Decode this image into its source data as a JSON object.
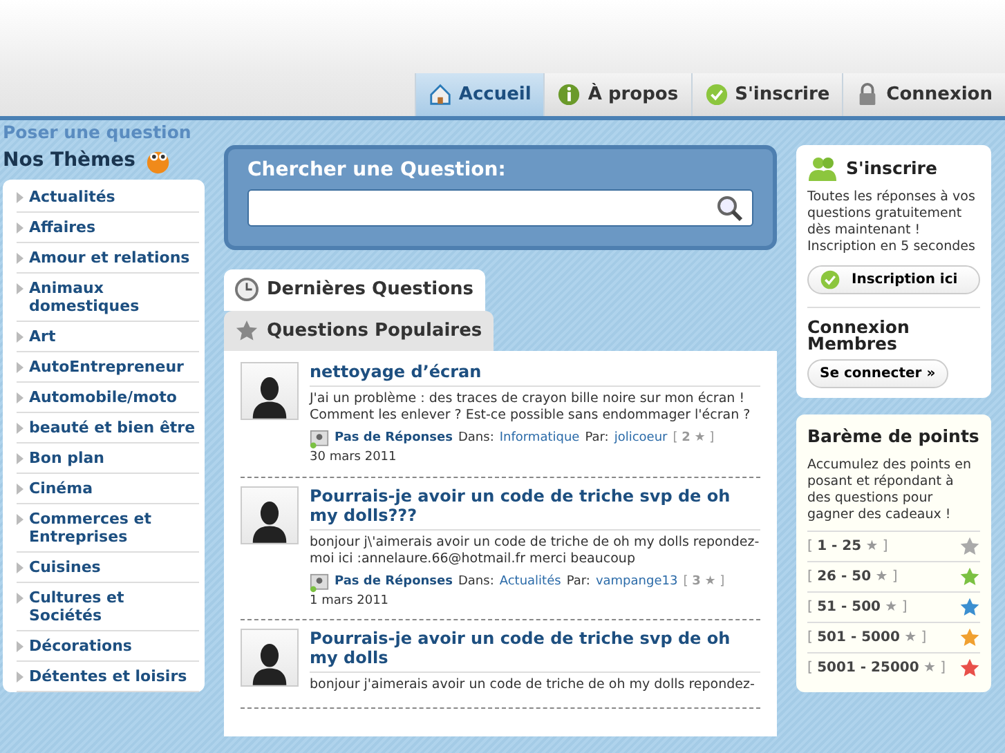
{
  "logo_text": "Poser une question",
  "nav": [
    {
      "label": "Accueil",
      "selected": true
    },
    {
      "label": "À propos",
      "selected": false
    },
    {
      "label": "S'inscrire",
      "selected": false
    },
    {
      "label": "Connexion",
      "selected": false
    }
  ],
  "sidebar": {
    "title": "Nos Thèmes",
    "items": [
      "Actualités",
      "Affaires",
      "Amour et relations",
      "Animaux domestiques",
      "Art",
      "AutoEntrepreneur",
      "Automobile/moto",
      "beauté et bien être",
      "Bon plan",
      "Cinéma",
      "Commerces et Entreprises",
      "Cuisines",
      "Cultures et Sociétés",
      "Décorations",
      "Détentes et loisirs"
    ]
  },
  "search": {
    "title": "Chercher une Question:"
  },
  "tabs": [
    {
      "label": "Dernières Questions",
      "selected": true
    },
    {
      "label": "Questions Populaires",
      "selected": false
    }
  ],
  "questions": [
    {
      "title": "nettoyage d’écran",
      "text": "J'ai un problème : des traces de crayon bille noire sur mon écran ! Comment les enlever ? Est-ce possible sans endommager l'écran ?",
      "status": "Pas de Réponses",
      "in_label": "Dans:",
      "category": "Informatique",
      "by_label": "Par:",
      "author": "jolicoeur",
      "points": "[ **2** ★ ]",
      "date": "30 mars 2011"
    },
    {
      "title": "Pourrais-je avoir un code de triche svp de oh my dolls???",
      "text": "bonjour j\\'aimerais avoir un code de triche de oh my dolls repondez-moi ici :annelaure.66@hotmail.fr merci beaucoup",
      "status": "Pas de Réponses",
      "in_label": "Dans:",
      "category": "Actualités",
      "by_label": "Par:",
      "author": "vampange13",
      "points": "[ **3** ★ ]",
      "date": "1 mars 2011"
    },
    {
      "title": "Pourrais-je avoir un code de triche svp de oh my dolls",
      "text": "bonjour j'aimerais avoir un code de triche de oh my dolls repondez-"
    }
  ],
  "signup": {
    "title": "S'inscrire",
    "text": "Toutes les réponses à vos questions gratuitement dès maintenant ! Inscription en 5 secondes",
    "button": "Inscription ici",
    "login_title": "Connexion Membres",
    "login_button": "Se connecter »"
  },
  "points": {
    "title": "Barème de points",
    "text": "Accumulez des points en posant et répondant à des questions pour gagner des cadeaux !",
    "levels": [
      {
        "range": "[ **1 - 25** ★ ]",
        "color": "#aaaaaa"
      },
      {
        "range": "[ **26 - 50** ★ ]",
        "color": "#7bc142"
      },
      {
        "range": "[ **51 - 500** ★ ]",
        "color": "#3b8fd0"
      },
      {
        "range": "[ **501 - 5000** ★ ]",
        "color": "#f0a030"
      },
      {
        "range": "[ **5001 - 25000** ★ ]",
        "color": "#e8504a"
      }
    ]
  }
}
